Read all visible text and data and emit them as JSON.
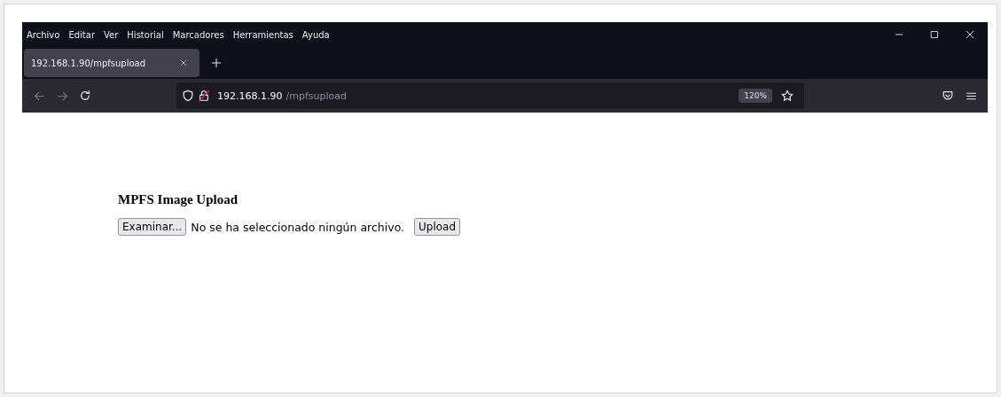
{
  "menu_bar": {
    "items": [
      "Archivo",
      "Editar",
      "Ver",
      "Historial",
      "Marcadores",
      "Herramientas",
      "Ayuda"
    ]
  },
  "tabs": [
    {
      "label": "192.168.1.90/mpfsupload",
      "selected": true
    }
  ],
  "address_bar": {
    "host": "192.168.1.90",
    "path": "/mpfsupload",
    "zoom": "120%"
  },
  "page": {
    "heading": "MPFS Image Upload",
    "browse_button": "Examinar...",
    "file_status": "No se ha seleccionado ningún archivo.",
    "upload_button": "Upload"
  }
}
